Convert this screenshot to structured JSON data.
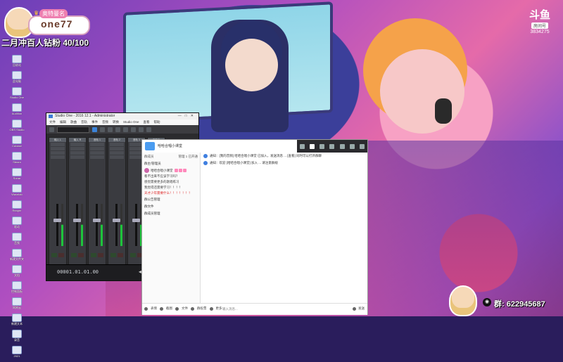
{
  "overlay": {
    "streamer_tag": "奥特曼名",
    "streamer_name": "one77",
    "goal_text": "二月冲百人钻粉 40/100",
    "douyu_logo": "斗鱼",
    "room_label": "房间号",
    "room_number": "3834275",
    "qq_text": "群: 622945687"
  },
  "desktop_icons": [
    {
      "label": "回收站"
    },
    {
      "label": "此电脑"
    },
    {
      "label": "Studio One"
    },
    {
      "label": "Audition"
    },
    {
      "label": "OBS Studio"
    },
    {
      "label": "Cubase"
    },
    {
      "label": "Steam"
    },
    {
      "label": "Sonar"
    },
    {
      "label": "Wavelab"
    },
    {
      "label": "Reaper"
    },
    {
      "label": "驱动"
    },
    {
      "label": "音频"
    },
    {
      "label": "新建文件夹"
    },
    {
      "label": "文档"
    },
    {
      "label": "控制面板"
    },
    {
      "label": "网易云"
    },
    {
      "label": "新建文本"
    },
    {
      "label": "录音"
    },
    {
      "label": "2021"
    }
  ],
  "studio": {
    "title": "Studio One - 2016 12.1 - Administrator",
    "menu": [
      "文件",
      "编辑",
      "歌曲",
      "音轨",
      "事件",
      "音频",
      "转换",
      "Studio One",
      "查看",
      "帮助"
    ],
    "time": "00001.01.01.00",
    "channels": [
      {
        "label": "输入 L"
      },
      {
        "label": "输入 R"
      },
      {
        "label": "音轨 1"
      },
      {
        "label": "音轨 2"
      },
      {
        "label": "音轨 3"
      },
      {
        "label": "主输出"
      }
    ]
  },
  "chat": {
    "group_name": "哈哈合唱小课堂",
    "left_title": "群成员",
    "left_meta": "管理 1 已开通",
    "section_owner": "群主/管理员",
    "owner_name": "哈哈合唱小课堂",
    "announcements_red": [
      "天才少年需要什么！！！！！！！"
    ],
    "announcements_dark": [
      "看不出来不应该学习吗？",
      "感觉需要更多的歌唱练习",
      "我觉得还需要学习！！！！"
    ],
    "sections": [
      "群公告管理",
      "群文件",
      "群成员管理"
    ],
    "messages": [
      {
        "text": "通知：[我的音频] 哈哈合唱小课堂 已加入，发送消息 ... [查看] 同时可以打开群聊"
      },
      {
        "text": "通知：欢迎 [哈哈合唱小课堂] 加入 ... 请注意群规"
      }
    ],
    "tools": [
      "表情",
      "截图",
      "文件",
      "群投票",
      "更多"
    ],
    "input_placeholder": "输入消息...",
    "send_label": "发送"
  }
}
